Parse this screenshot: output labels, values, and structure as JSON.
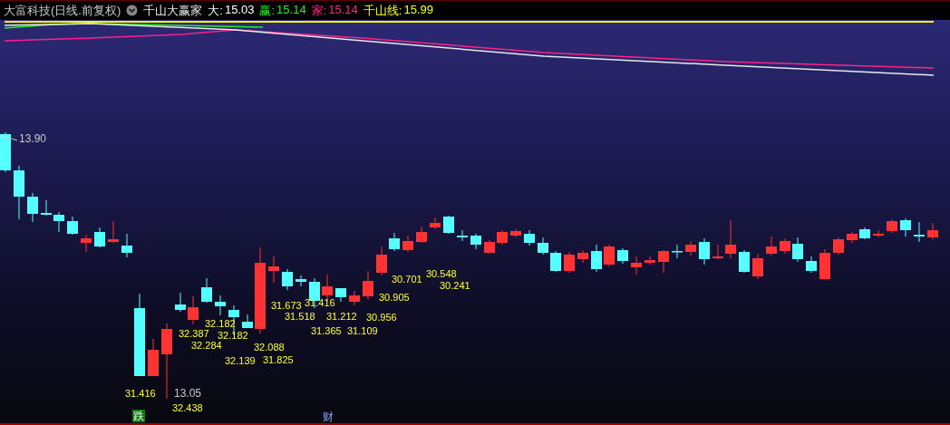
{
  "header": {
    "title": "大富科技(日线.前复权)",
    "indicator_name": "千山大赢家",
    "values": [
      {
        "label": "大:",
        "value": "15.03"
      },
      {
        "label": "赢:",
        "value": "15.14"
      },
      {
        "label": "家:",
        "value": "15.14"
      },
      {
        "label": "千山线:",
        "value": "15.99"
      }
    ]
  },
  "chart": {
    "high_label": "13.90",
    "low_label": "13.05",
    "price_labels": [
      "32.182",
      "32.387",
      "32.182",
      "32.284",
      "32.139",
      "32.088",
      "31.825",
      "31.673",
      "31.416",
      "31.518",
      "31.212",
      "31.365",
      "31.109",
      "30.956",
      "30.905",
      "30.701",
      "30.548",
      "30.241",
      "31.416",
      "32.438"
    ],
    "event_markers": [
      {
        "text": "跌",
        "kind": "badge"
      },
      {
        "text": "财",
        "kind": "text"
      }
    ]
  }
}
